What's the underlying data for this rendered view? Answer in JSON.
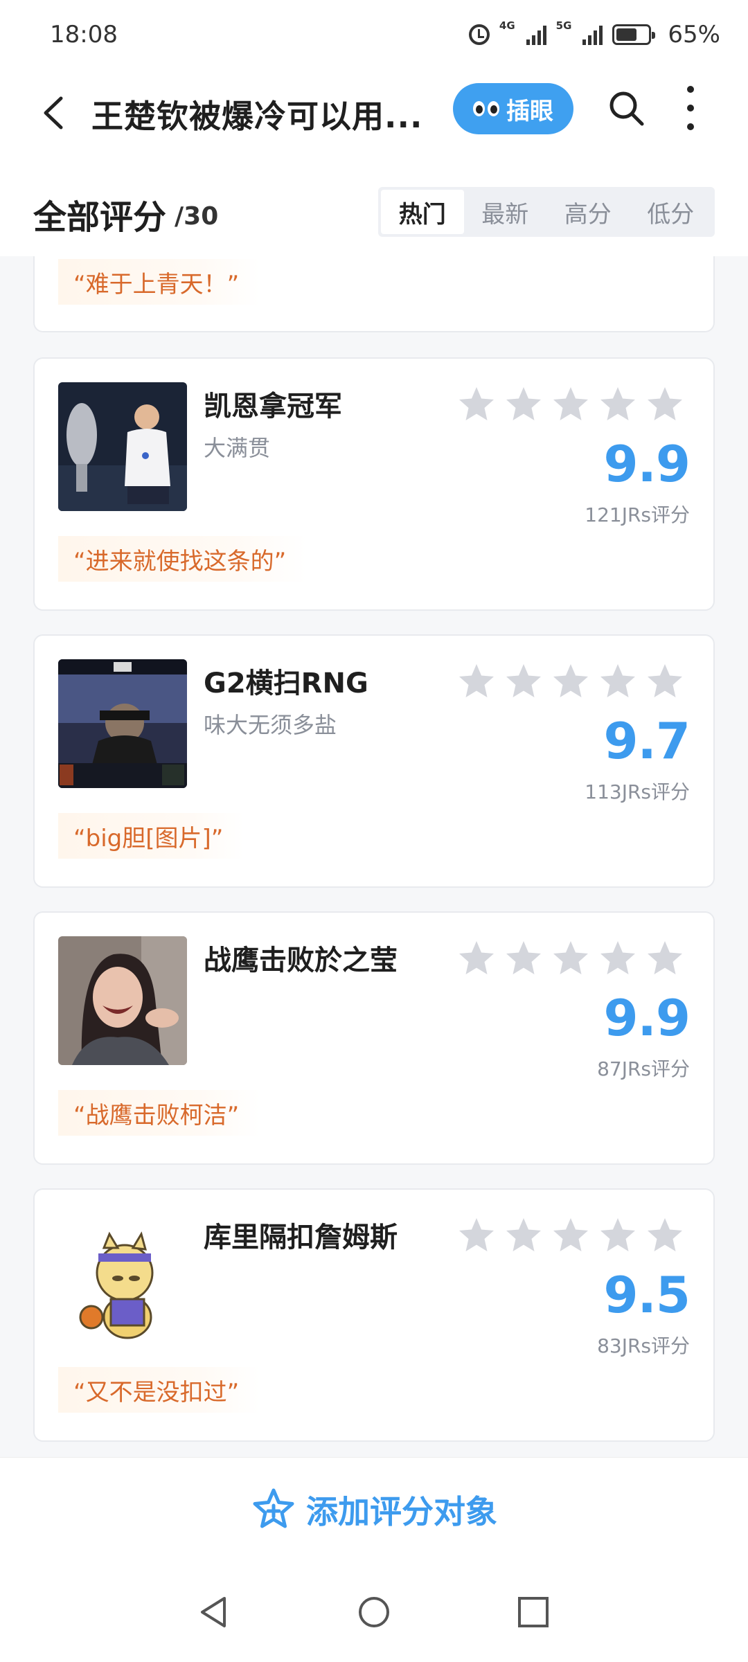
{
  "status_bar": {
    "time": "18:08",
    "net1": "4G",
    "net2": "5G",
    "battery_pct": "65%",
    "battery_level": 0.65,
    "icons": [
      "alarm-icon",
      "signal-icon",
      "signal-icon",
      "battery-icon"
    ]
  },
  "nav": {
    "title": "王楚钦被爆冷可以用...",
    "peek_label": "插眼",
    "icons": [
      "back-icon",
      "eyes-icon",
      "search-icon",
      "more-icon"
    ]
  },
  "section": {
    "title": "全部评分",
    "count": "/30",
    "tabs": [
      "热门",
      "最新",
      "高分",
      "低分"
    ],
    "active_tab": "热门"
  },
  "partial_card": {
    "quote": "“难于上青天！”"
  },
  "items": [
    {
      "title": "凯恩拿冠军",
      "subtitle": "大满贯",
      "score": "9.9",
      "votes": "121JRs评分",
      "quote": "“进来就使找这条的”",
      "stars_filled": 0
    },
    {
      "title": "G2横扫RNG",
      "subtitle": "味大无须多盐",
      "score": "9.7",
      "votes": "113JRs评分",
      "quote": "“big胆[图片]”",
      "stars_filled": 0
    },
    {
      "title": "战鹰击败於之莹",
      "subtitle": "",
      "score": "9.9",
      "votes": "87JRs评分",
      "quote": "“战鹰击败柯洁”",
      "stars_filled": 0
    },
    {
      "title": "库里隔扣詹姆斯",
      "subtitle": "",
      "score": "9.5",
      "votes": "83JRs评分",
      "quote": "“又不是没扣过”",
      "stars_filled": 0
    }
  ],
  "bottom": {
    "add_label": "添加评分对象",
    "icon": "star-add-icon"
  },
  "system_nav": {
    "icons": [
      "nav-back-icon",
      "home-icon",
      "recents-icon"
    ]
  },
  "colors": {
    "accent": "#3d9bee",
    "quote_text": "#d8692b",
    "quote_bg": "#fff6ec",
    "star_empty": "#d4d6dc"
  }
}
